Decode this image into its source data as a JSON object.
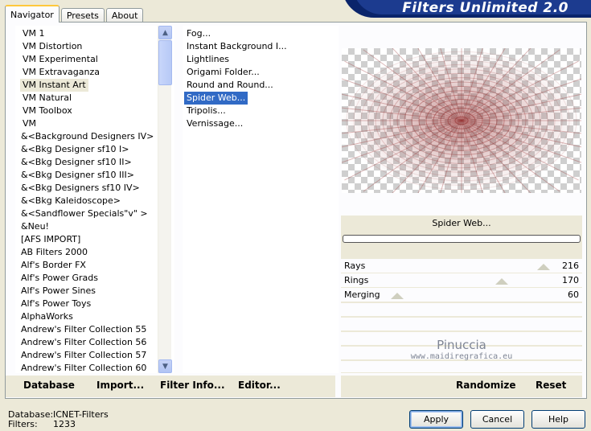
{
  "app_title": "Filters Unlimited 2.0",
  "tabs": [
    {
      "label": "Navigator",
      "active": true
    },
    {
      "label": "Presets",
      "active": false
    },
    {
      "label": "About",
      "active": false
    }
  ],
  "categories": [
    "VM 1",
    "VM Distortion",
    "VM Experimental",
    "VM Extravaganza",
    "VM Instant Art",
    "VM Natural",
    "VM Toolbox",
    "VM",
    "&<Background Designers IV>",
    "&<Bkg Designer sf10 I>",
    "&<Bkg Designer sf10 II>",
    "&<Bkg Designer sf10 III>",
    "&<Bkg Designers sf10 IV>",
    "&<Bkg Kaleidoscope>",
    "&<Sandflower Specials\"v\" >",
    "&Neu!",
    "[AFS IMPORT]",
    "AB Filters 2000",
    "Alf's Border FX",
    "Alf's Power Grads",
    "Alf's Power Sines",
    "Alf's Power Toys",
    "AlphaWorks",
    "Andrew's Filter Collection 55",
    "Andrew's Filter Collection 56",
    "Andrew's Filter Collection 57",
    "Andrew's Filter Collection 60"
  ],
  "selected_category": "VM Instant Art",
  "filters": [
    "Fog...",
    "Instant Background I...",
    "Lightlines",
    "Origami Folder...",
    "Round and Round...",
    "Spider Web...",
    "Tripolis...",
    "Vernissage..."
  ],
  "selected_filter": "Spider Web...",
  "preview_filter_name": "Spider Web...",
  "params": [
    {
      "label": "Rays",
      "value": 216
    },
    {
      "label": "Rings",
      "value": 170
    },
    {
      "label": "Merging",
      "value": 60
    }
  ],
  "watermark": {
    "name": "Pinuccia",
    "url": "www.maidiregrafica.eu"
  },
  "panel_buttons": {
    "database": "Database",
    "import": "Import...",
    "filter_info": "Filter Info...",
    "editor": "Editor...",
    "randomize": "Randomize",
    "reset": "Reset"
  },
  "status": {
    "database_label": "Database:",
    "database_value": "ICNET-Filters",
    "filters_label": "Filters:",
    "filters_value": "1233"
  },
  "dialog_buttons": {
    "apply": "Apply",
    "cancel": "Cancel",
    "help": "Help"
  },
  "colors": {
    "accent": "#316ac5",
    "banner": "#0a246a",
    "web": "#9a3a3a"
  }
}
